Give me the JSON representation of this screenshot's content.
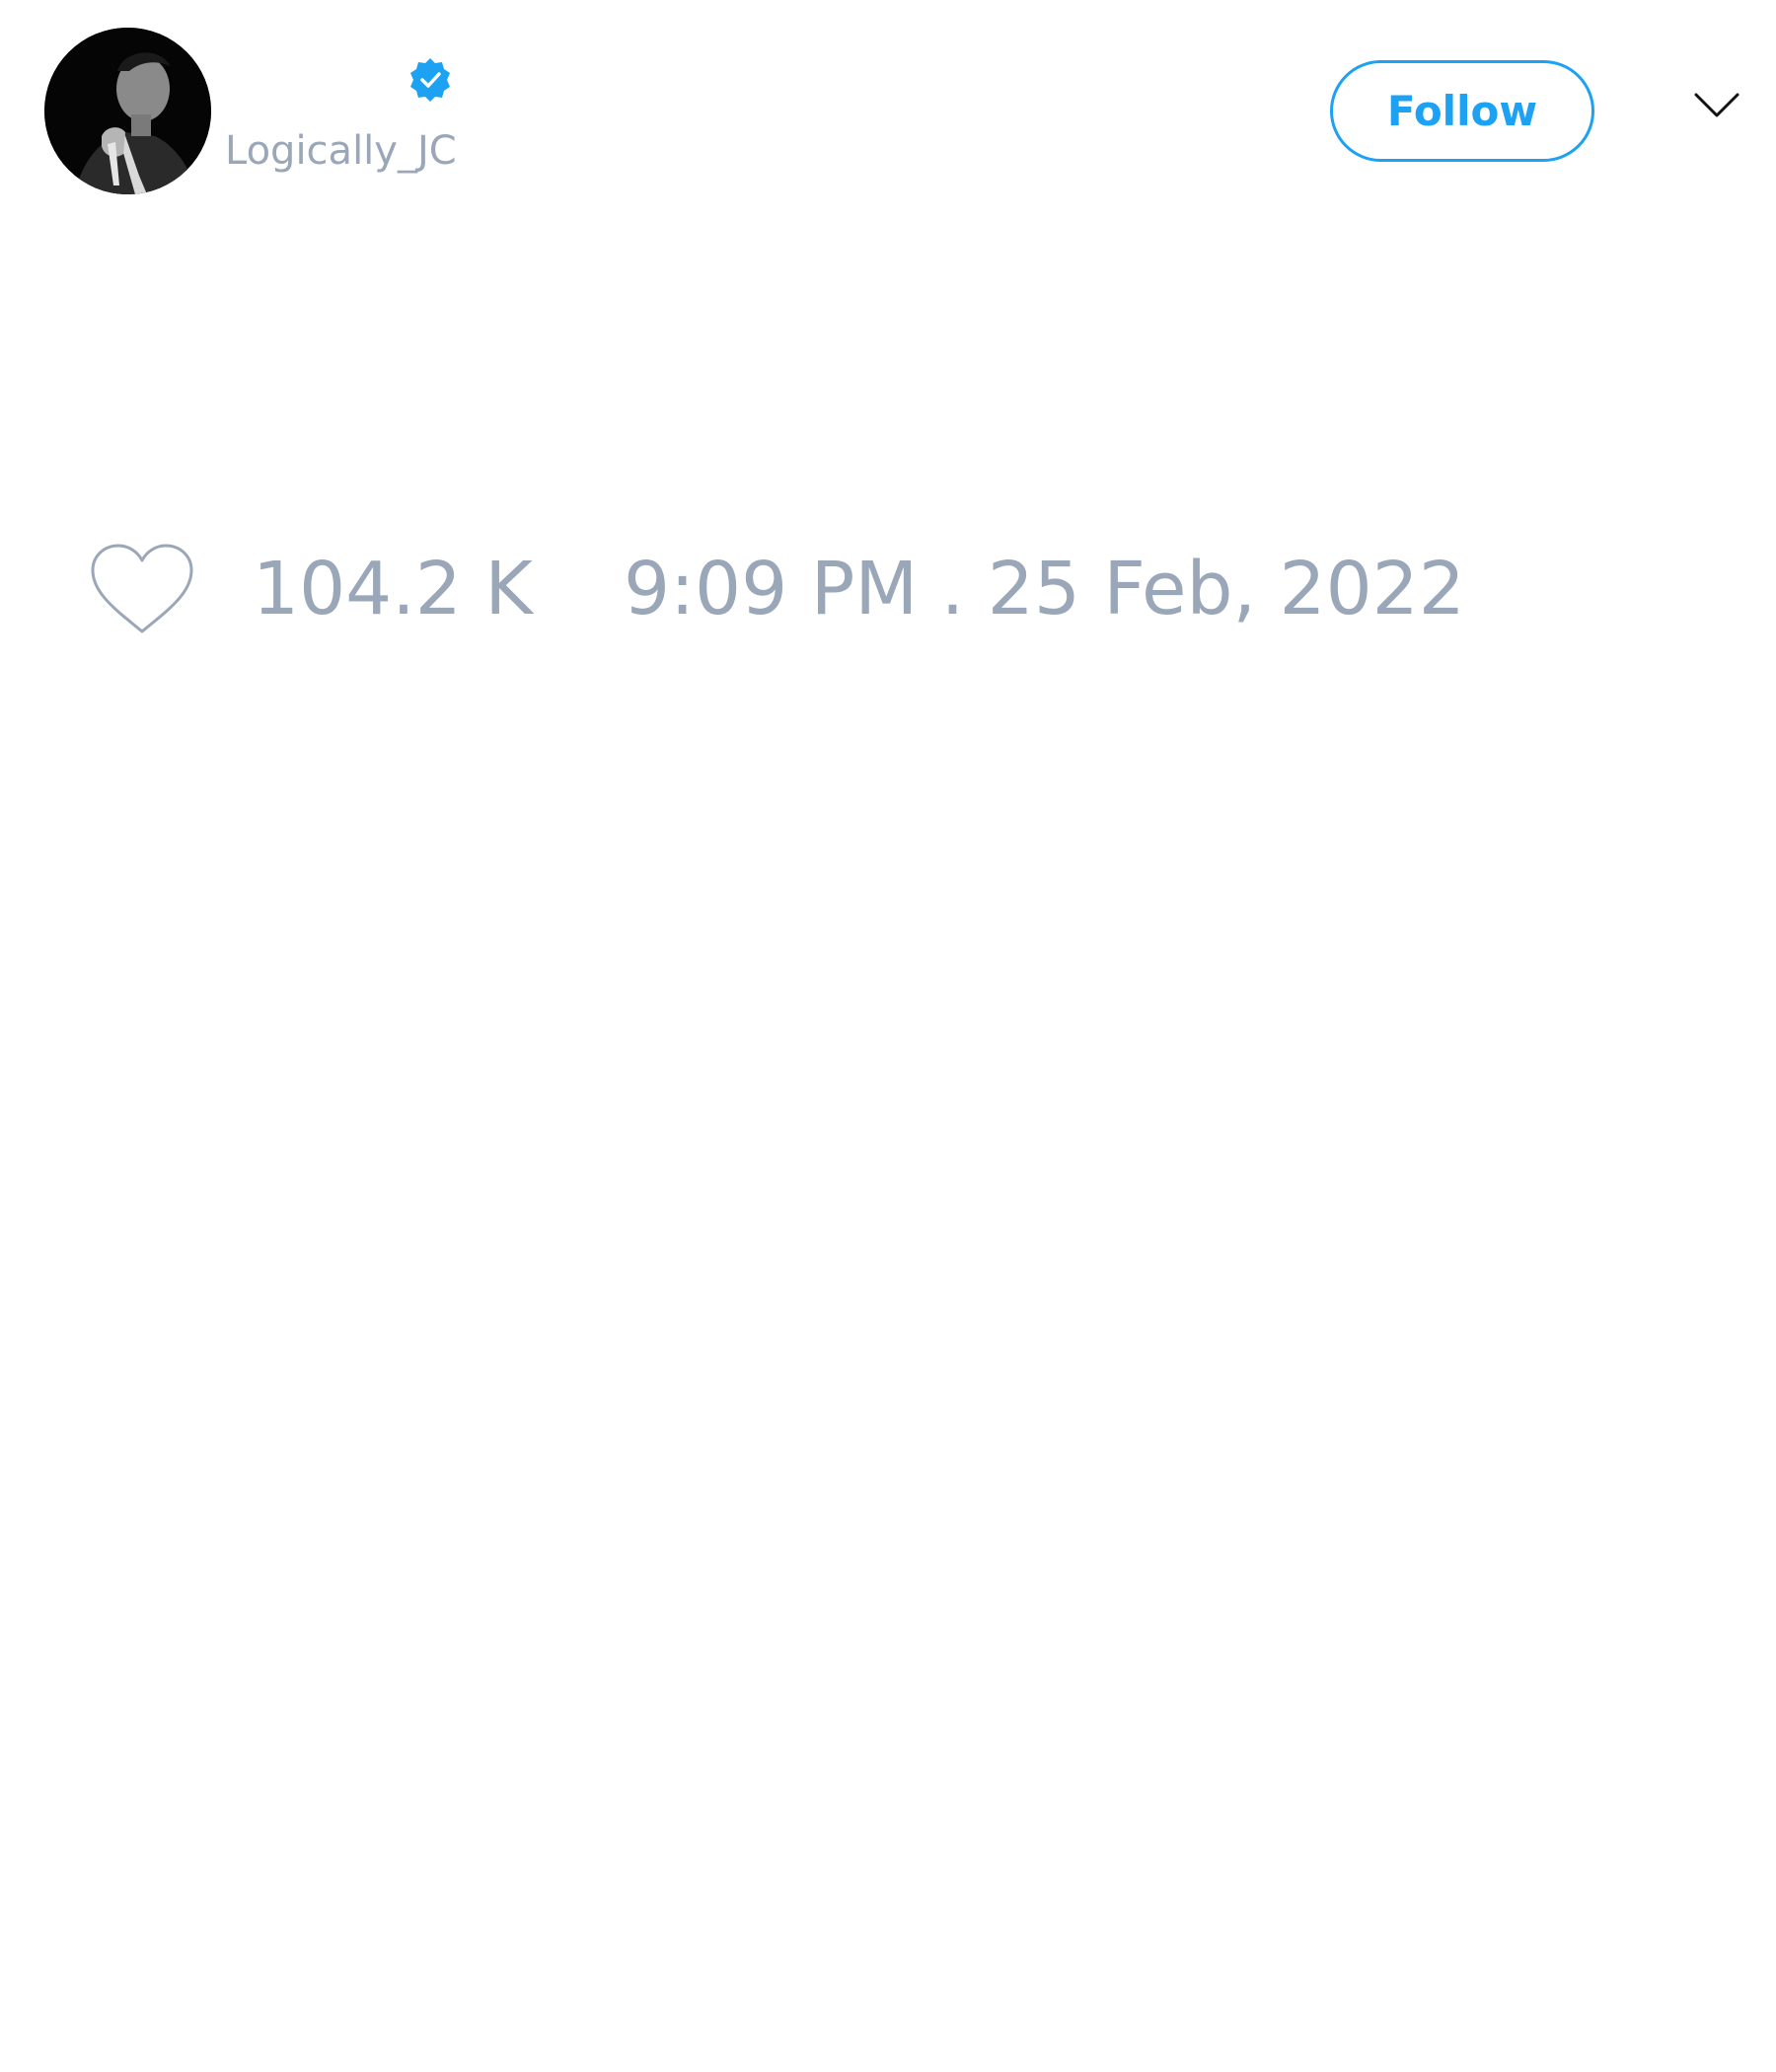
{
  "tweet": {
    "author": {
      "handle": "Logically_JC",
      "avatar_icon": "profile-photo",
      "verified_icon": "verified-badge-icon"
    },
    "header": {
      "follow_label": "Follow",
      "menu_icon": "chevron-down-icon"
    },
    "stats": {
      "like_icon": "heart-icon",
      "likes": "104.2 K",
      "timestamp": "9:09 PM . 25 Feb, 2022"
    }
  },
  "colors": {
    "accent": "#1da1f2",
    "muted_text": "#9aa7b8",
    "background": "#ffffff"
  }
}
